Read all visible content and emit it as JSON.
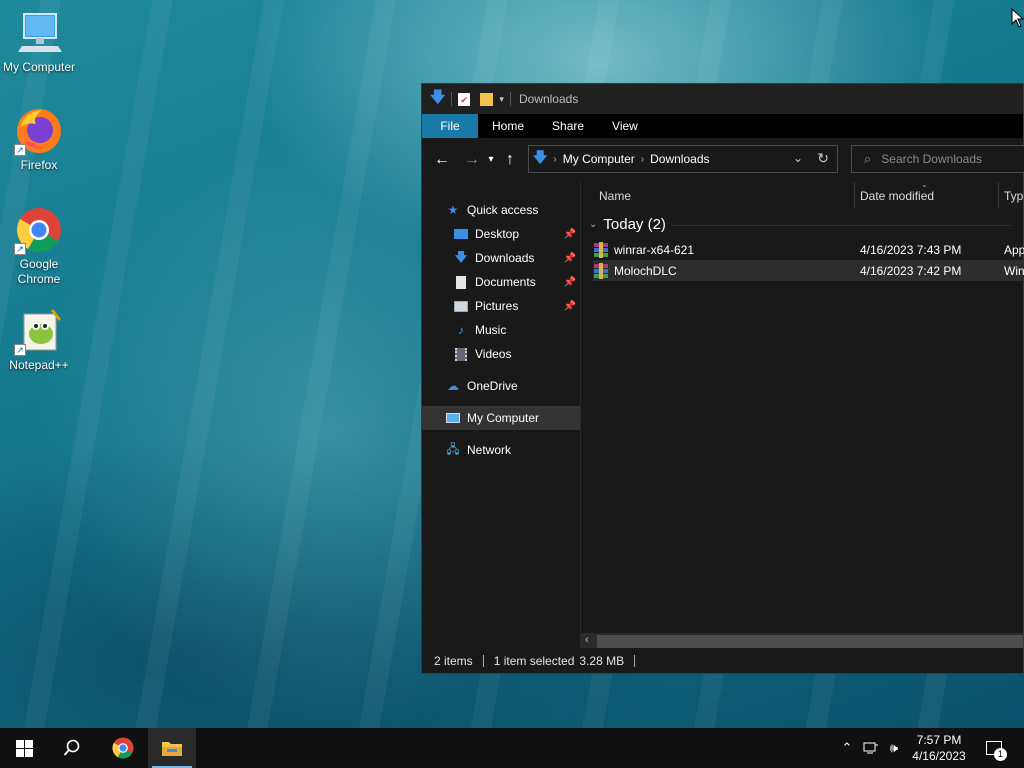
{
  "desktop": {
    "icons": [
      {
        "label": "My Computer",
        "icon": "computer-icon"
      },
      {
        "label": "Firefox",
        "icon": "firefox-icon"
      },
      {
        "label_line1": "Google",
        "label_line2": "Chrome",
        "icon": "chrome-icon"
      },
      {
        "label": "Notepad++",
        "icon": "notepadpp-icon"
      }
    ]
  },
  "explorer": {
    "title": "Downloads",
    "ribbon_tabs": [
      "File",
      "Home",
      "Share",
      "View"
    ],
    "address": {
      "segments": [
        "My Computer",
        "Downloads"
      ]
    },
    "search": {
      "placeholder": "Search Downloads"
    },
    "nav_pane": [
      {
        "label": "Quick access",
        "icon": "star-icon"
      },
      {
        "label": "Desktop",
        "icon": "desktop-folder-icon",
        "pinned": true
      },
      {
        "label": "Downloads",
        "icon": "download-arrow-icon",
        "pinned": true
      },
      {
        "label": "Documents",
        "icon": "document-icon",
        "pinned": true
      },
      {
        "label": "Pictures",
        "icon": "picture-icon",
        "pinned": true
      },
      {
        "label": "Music",
        "icon": "music-note-icon"
      },
      {
        "label": "Videos",
        "icon": "video-icon"
      },
      {
        "label": "OneDrive",
        "icon": "cloud-icon"
      },
      {
        "label": "My Computer",
        "icon": "computer-icon",
        "selected": true
      },
      {
        "label": "Network",
        "icon": "network-icon"
      }
    ],
    "columns": [
      "Name",
      "Date modified",
      "Type"
    ],
    "group": {
      "label": "Today (2)"
    },
    "files": [
      {
        "name": "winrar-x64-621",
        "date": "4/16/2023 7:43 PM",
        "type": "App",
        "icon": "winrar-icon"
      },
      {
        "name": "MolochDLC",
        "date": "4/16/2023 7:42 PM",
        "type": "Win",
        "icon": "winrar-icon",
        "selected": true
      }
    ],
    "status": {
      "items": "2 items",
      "selected": "1 item selected",
      "size": "3.28 MB"
    }
  },
  "taskbar": {
    "clock_time": "7:57 PM",
    "clock_date": "4/16/2023",
    "notification_count": "1"
  },
  "colors": {
    "accent": "#1979a9",
    "dark_bg": "#191919",
    "taskbar": "#101010"
  }
}
